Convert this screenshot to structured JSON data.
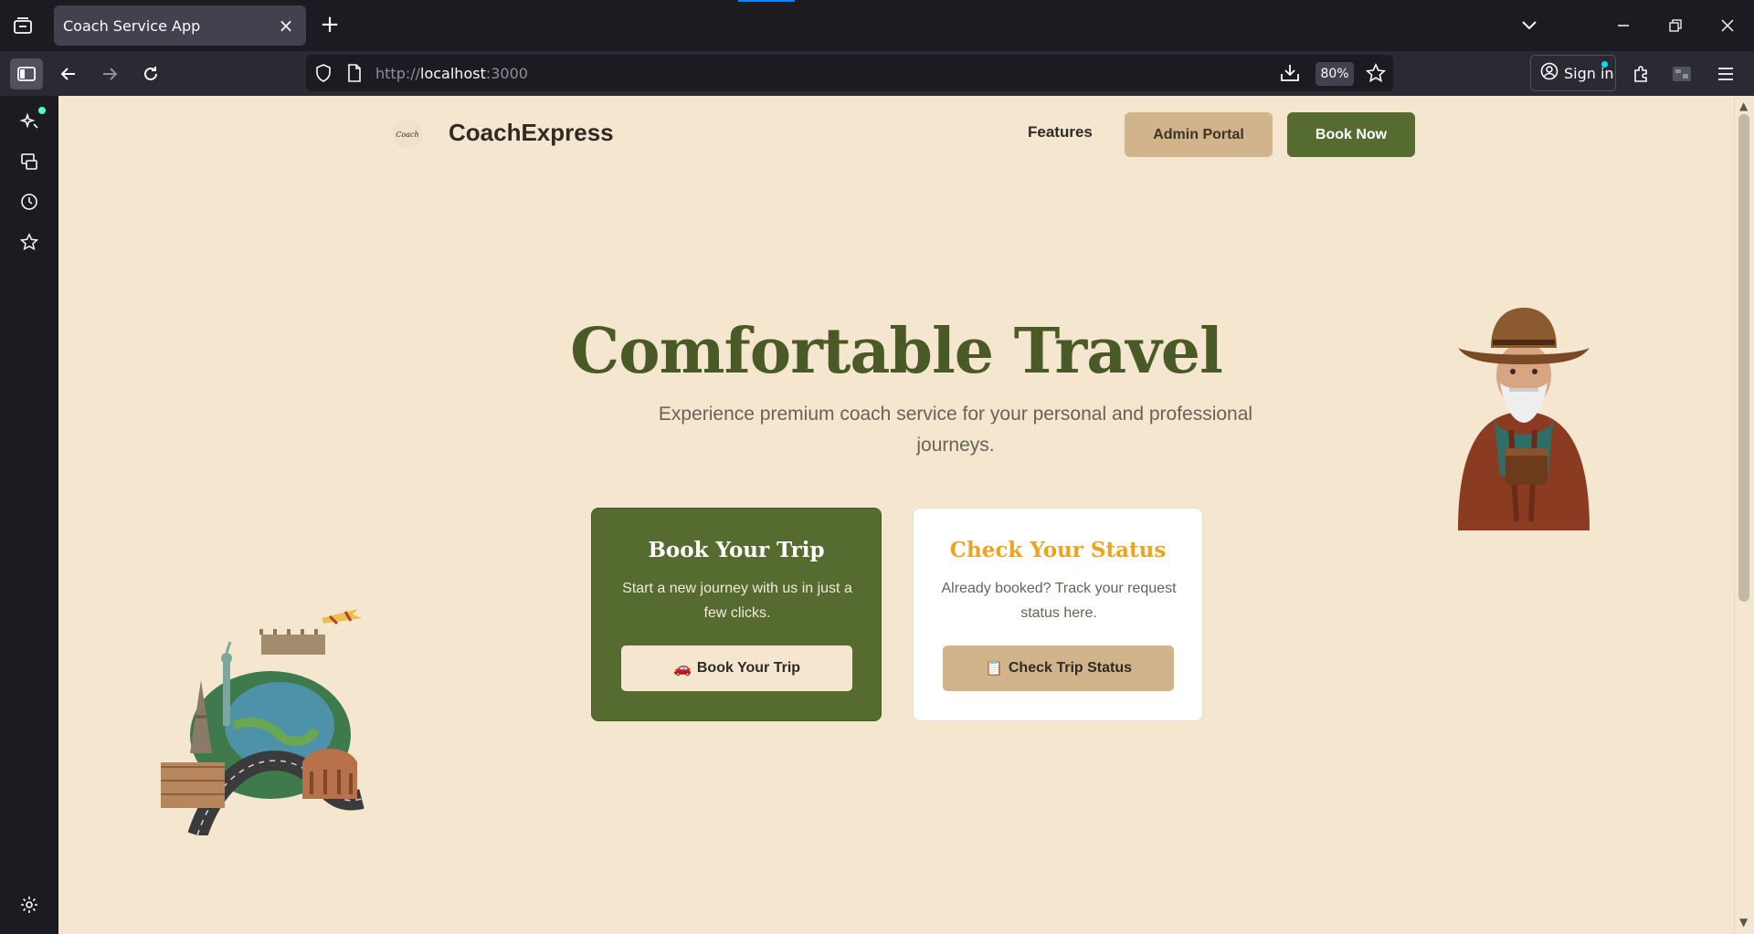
{
  "browser": {
    "tab_title": "Coach Service App",
    "url_prefix": "http://",
    "url_host": "localhost",
    "url_suffix": ":3000",
    "zoom": "80%",
    "signin_label": "Sign in"
  },
  "site": {
    "logo_text": "Coach",
    "brand": "CoachExpress",
    "nav": {
      "features": "Features",
      "admin": "Admin Portal",
      "book": "Book Now"
    },
    "hero": {
      "title": "Comfortable Travel",
      "subtitle": "Experience premium coach service for your personal and professional journeys."
    },
    "cards": [
      {
        "title": "Book Your Trip",
        "description": "Start a new journey with us in just a few clicks.",
        "button_icon": "🚗",
        "button_label": "Book Your Trip"
      },
      {
        "title": "Check Your Status",
        "description": "Already booked? Track your request status here.",
        "button_icon": "📋",
        "button_label": "Check Trip Status"
      }
    ]
  },
  "colors": {
    "page_bg": "#f4e6cf",
    "olive": "#556b2f",
    "tan": "#d2b48c",
    "status_accent": "#f0a21f"
  }
}
